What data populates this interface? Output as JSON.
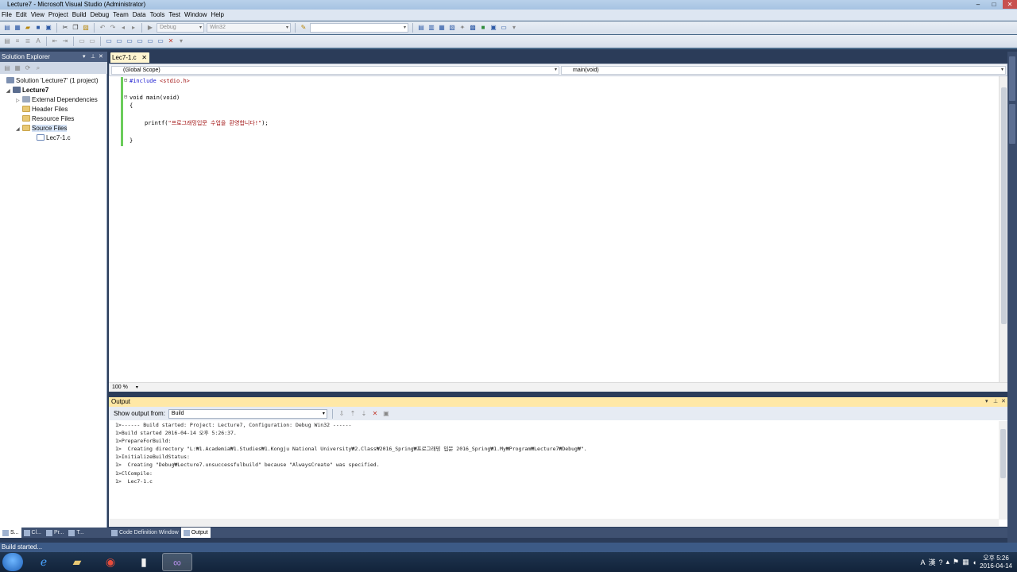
{
  "window": {
    "title": "Lecture7 - Microsoft Visual Studio (Administrator)"
  },
  "menu": [
    "File",
    "Edit",
    "View",
    "Project",
    "Build",
    "Debug",
    "Team",
    "Data",
    "Tools",
    "Test",
    "Window",
    "Help"
  ],
  "toolbar": {
    "config": "Debug",
    "platform": "Win32",
    "find": ""
  },
  "solution_explorer": {
    "title": "Solution Explorer",
    "items": [
      {
        "label": "Solution 'Lecture7' (1 project)"
      },
      {
        "label": "Lecture7"
      },
      {
        "label": "External Dependencies"
      },
      {
        "label": "Header Files"
      },
      {
        "label": "Resource Files"
      },
      {
        "label": "Source Files"
      },
      {
        "label": "Lec7-1.c"
      }
    ],
    "tabs": [
      "S...",
      "Cl...",
      "Pr...",
      "T..."
    ]
  },
  "editor": {
    "tab": "Lec7-1.c",
    "scope": "(Global Scope)",
    "member": "main(void)",
    "zoom": "100 %",
    "code": {
      "include_kw": "#include",
      "include_file": "<stdio.h>",
      "main_sig": "void main(void)",
      "open": "{",
      "printf_call": "printf(",
      "printf_str": "\"프로그래밍입문 수업을 환영합니다!\"",
      "printf_end": ");",
      "close": "}"
    }
  },
  "output": {
    "title": "Output",
    "show_from_label": "Show output from:",
    "source": "Build",
    "lines": [
      "1>------ Build started: Project: Lecture7, Configuration: Debug Win32 ------",
      "1>Build started 2016-04-14 오후 5:26:37.",
      "1>PrepareForBuild:",
      "1>  Creating directory \"L:₩1.Academia₩1.Studies₩1.Kongju National University₩2.Class₩2016_Spring₩프로그래밍 입문 2016_Spring₩1.My₩Program₩Lecture7₩Debug₩\".",
      "1>InitializeBuildStatus:",
      "1>  Creating \"Debug₩Lecture7.unsuccessfulbuild\" because \"AlwaysCreate\" was specified.",
      "1>ClCompile:",
      "1>  Lec7-1.c"
    ]
  },
  "bottom_tabs": [
    "Code Definition Window",
    "Output"
  ],
  "status": {
    "text": "Build started..."
  },
  "taskbar": {
    "lang": "A",
    "ime": "漢",
    "time": "오후 5:26",
    "date": "2016-04-14"
  },
  "colors": {
    "accent": "#4d6082",
    "active_tab": "#fff5d0",
    "output_header": "#ffe8a6",
    "keyword": "#1a1ad0",
    "string": "#a31515"
  }
}
